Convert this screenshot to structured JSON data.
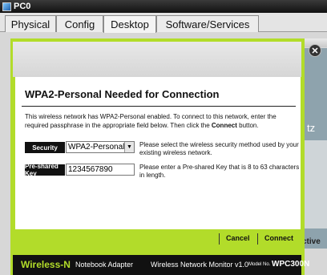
{
  "window": {
    "title": "PC0"
  },
  "tabs": [
    {
      "label": "Physical"
    },
    {
      "label": "Config"
    },
    {
      "label": "Desktop"
    },
    {
      "label": "Software/Services"
    }
  ],
  "background": {
    "fragment_tz": "tz",
    "fragment_active": "ctive"
  },
  "dialog": {
    "title": "WPA2-Personal Needed for Connection",
    "description_1": "This wireless network has WPA2-Personal enabled. To connect to this network, enter the required passphrase in the appropriate field below. Then click the ",
    "description_bold": "Connect",
    "description_2": " button.",
    "security": {
      "label": "Security",
      "value": "WPA2-Personal",
      "help": "Please select the wireless security method used by your existing wireless network."
    },
    "psk": {
      "label": "Pre-shared Key",
      "value": "1234567890",
      "help": "Please enter a Pre-shared Key that is 8 to 63 characters in length."
    },
    "cancel_label": "Cancel",
    "connect_label": "Connect"
  },
  "footer": {
    "brand": "Wireless-N",
    "product": "Notebook Adapter",
    "monitor": "Wireless Network Monitor  v1.0",
    "model_label": "Model No.",
    "model_value": "WPC300N"
  },
  "colors": {
    "accent_green": "#b2dc2a",
    "title_bar": "#111111"
  },
  "icons": {
    "app": "pc-icon",
    "close": "close-icon",
    "dropdown": "chevron-down-icon"
  }
}
